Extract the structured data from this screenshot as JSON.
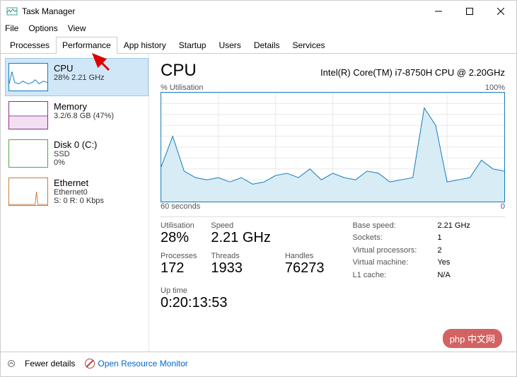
{
  "window": {
    "title": "Task Manager"
  },
  "menu": [
    "File",
    "Options",
    "View"
  ],
  "tabs": [
    "Processes",
    "Performance",
    "App history",
    "Startup",
    "Users",
    "Details",
    "Services"
  ],
  "sidebar": {
    "cpu": {
      "label": "CPU",
      "sub": "28% 2.21 GHz",
      "color": "#117dbb"
    },
    "memory": {
      "label": "Memory",
      "sub": "3.2/6.8 GB (47%)",
      "color": "#8b2f8b"
    },
    "disk": {
      "label": "Disk 0 (C:)",
      "sub": "SSD\n0%",
      "color": "#4ca64c"
    },
    "ethernet": {
      "label": "Ethernet",
      "sub": "Ethernet0\nS: 0 R: 0 Kbps",
      "color": "#c97a3b"
    }
  },
  "header": {
    "title": "CPU",
    "model": "Intel(R) Core(TM) i7-8750H CPU @ 2.20GHz",
    "chart_top_left": "% Utilisation",
    "chart_top_right": "100%",
    "chart_bottom_left": "60 seconds",
    "chart_bottom_right": "0"
  },
  "stats": {
    "util_label": "Utilisation",
    "util": "28%",
    "speed_label": "Speed",
    "speed": "2.21 GHz",
    "proc_label": "Processes",
    "proc": "172",
    "thr_label": "Threads",
    "thr": "1933",
    "hnd_label": "Handles",
    "hnd": "76273",
    "up_label": "Up time",
    "up": "0:20:13:53"
  },
  "right": {
    "base_l": "Base speed:",
    "base_v": "2.21 GHz",
    "sock_l": "Sockets:",
    "sock_v": "1",
    "vp_l": "Virtual processors:",
    "vp_v": "2",
    "vm_l": "Virtual machine:",
    "vm_v": "Yes",
    "l1_l": "L1 cache:",
    "l1_v": "N/A"
  },
  "footer": {
    "fewer": "Fewer details",
    "monitor": "Open Resource Monitor"
  },
  "watermark": "php 中文网",
  "chart_data": {
    "type": "line",
    "title": "CPU % Utilisation",
    "xlabel": "seconds",
    "ylabel": "% Utilisation",
    "xlim": [
      0,
      60
    ],
    "ylim": [
      0,
      100
    ],
    "x": [
      0,
      2,
      4,
      6,
      8,
      10,
      12,
      14,
      16,
      18,
      20,
      22,
      24,
      26,
      28,
      30,
      32,
      34,
      36,
      38,
      40,
      42,
      44,
      46,
      48,
      50,
      52,
      54,
      56,
      58,
      60
    ],
    "values": [
      32,
      60,
      28,
      22,
      20,
      22,
      18,
      22,
      16,
      18,
      24,
      26,
      22,
      30,
      20,
      26,
      22,
      20,
      28,
      26,
      18,
      20,
      22,
      86,
      70,
      18,
      20,
      22,
      38,
      30,
      28
    ]
  }
}
